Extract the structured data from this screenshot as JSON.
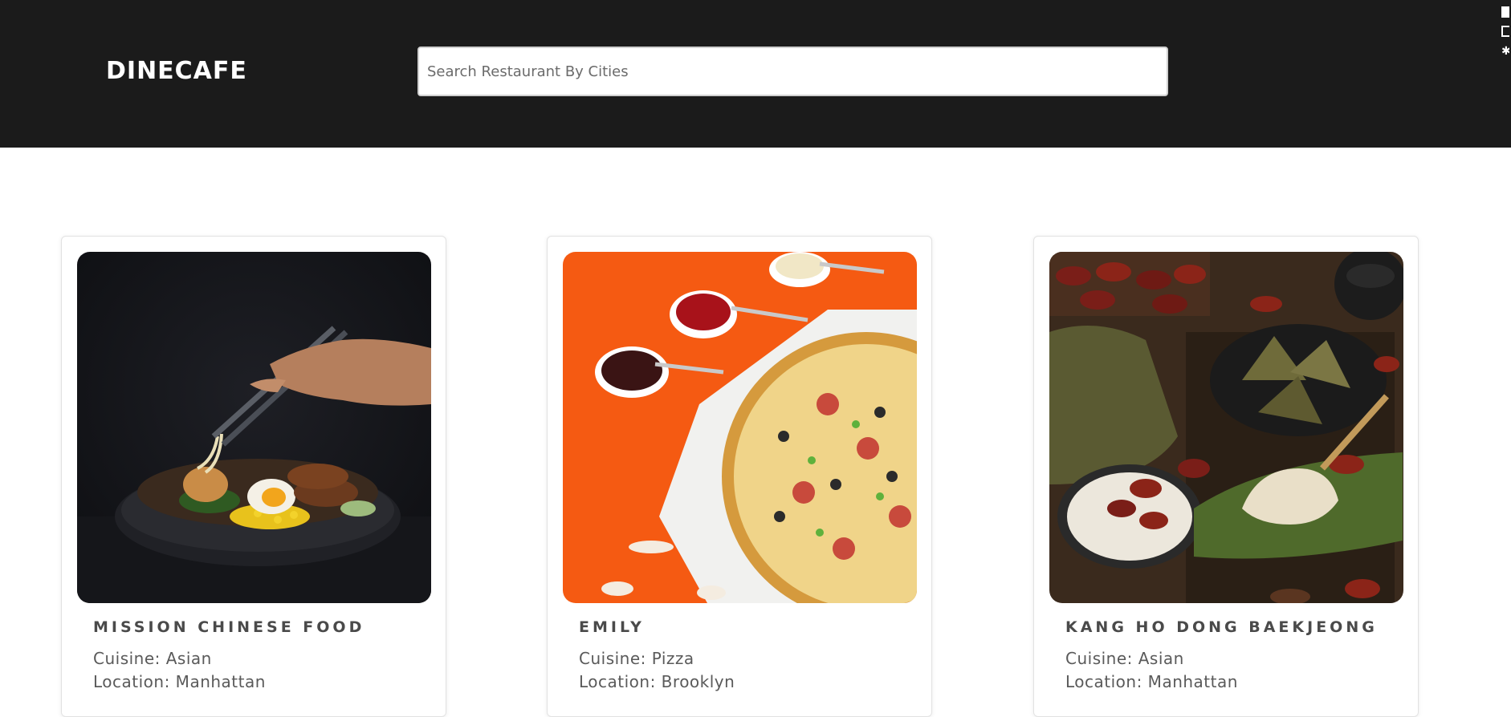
{
  "header": {
    "brand": "DINECAFE",
    "search_placeholder": "Search Restaurant By Cities"
  },
  "restaurants": [
    {
      "name": "MISSION CHINESE FOOD",
      "cuisine_label": "Cuisine: Asian",
      "location_label": "Location: Manhattan",
      "image_icon": "ramen-bowl-photo"
    },
    {
      "name": "EMILY",
      "cuisine_label": "Cuisine: Pizza",
      "location_label": "Location: Brooklyn",
      "image_icon": "pizza-photo"
    },
    {
      "name": "KANG HO DONG BAEKJEONG",
      "cuisine_label": "Cuisine: Asian",
      "location_label": "Location: Manhattan",
      "image_icon": "zongzi-photo"
    }
  ],
  "colors": {
    "header_bg": "#1b1b1b",
    "page_bg": "#ffffff",
    "card_title": "#4a4a4a",
    "card_text": "#5a5a5a"
  }
}
